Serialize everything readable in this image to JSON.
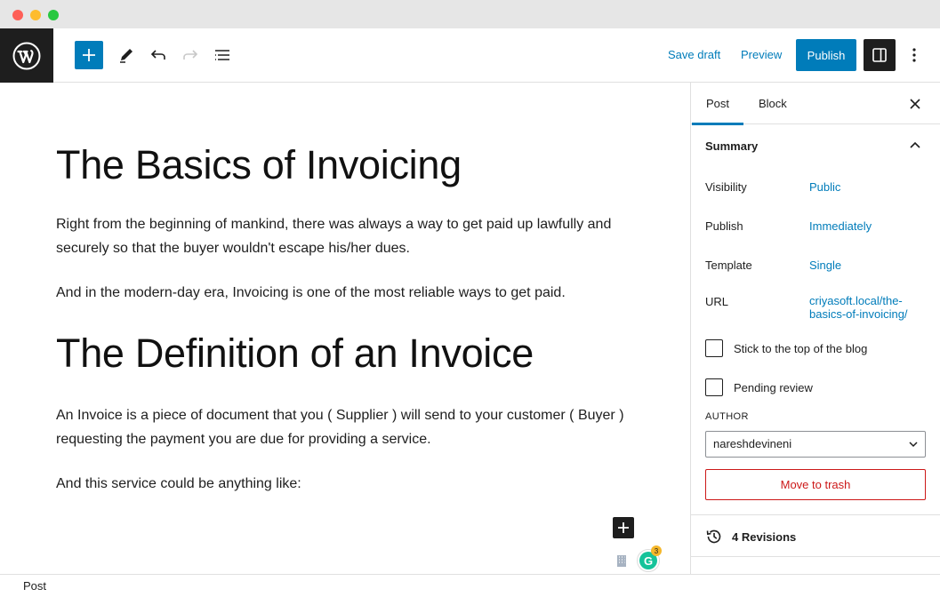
{
  "header": {
    "save_draft": "Save draft",
    "preview": "Preview",
    "publish": "Publish"
  },
  "content": {
    "heading1": "The Basics of Invoicing",
    "para1": "Right from the beginning of mankind, there was always a way to get paid up lawfully and securely so that the buyer wouldn't escape his/her dues.",
    "para2": "And in the modern-day era, Invoicing is one of the most reliable ways to get paid.",
    "heading2": "The Definition of an Invoice",
    "para3": "An Invoice is a piece of document that you ( Supplier ) will send to your customer ( Buyer ) requesting the payment you are due for providing a service.",
    "para4": "And this service could be anything like:",
    "grammarly_letter": "G",
    "grammarly_count": "3"
  },
  "sidebar": {
    "tab_post": "Post",
    "tab_block": "Block",
    "summary": "Summary",
    "visibility_label": "Visibility",
    "visibility_value": "Public",
    "publish_label": "Publish",
    "publish_value": "Immediately",
    "template_label": "Template",
    "template_value": "Single",
    "url_label": "URL",
    "url_value_line1": "criyasoft.local/the-",
    "url_value_line2": "basics-of-invoicing/",
    "stick_label": "Stick to the top of the blog",
    "pending_label": "Pending review",
    "author_label": "AUTHOR",
    "author_value": "nareshdevineni",
    "trash": "Move to trash",
    "revisions": "4 Revisions"
  },
  "footer": {
    "breadcrumb": "Post"
  },
  "colors": {
    "accent": "#007cba",
    "danger": "#cc1818",
    "dark": "#1e1e1e"
  }
}
